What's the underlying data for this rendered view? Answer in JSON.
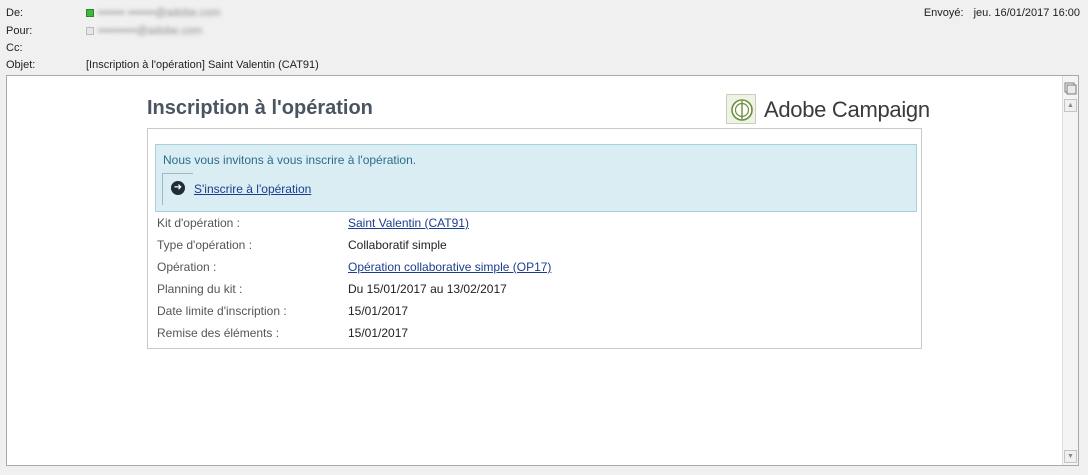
{
  "header": {
    "from_label": "De:",
    "from_value": "••••••• •••••••@adobe.com",
    "to_label": "Pour:",
    "to_value": "••••••••••@adobe.com",
    "cc_label": "Cc:",
    "subject_label": "Objet:",
    "subject_value": "[Inscription à l'opération] Saint Valentin (CAT91)",
    "sent_label": "Envoyé:",
    "sent_value": "jeu. 16/01/2017 16:00"
  },
  "email": {
    "title": "Inscription à l'opération",
    "brand": "Adobe Campaign",
    "invite_text": "Nous vous invitons à vous inscrire à l'opération.",
    "invite_link": "S'inscrire à l'opération",
    "details": [
      {
        "label": "Kit d'opération :",
        "value": "Saint Valentin (CAT91)"
      },
      {
        "label": "Type d'opération :",
        "value": "Collaboratif simple"
      },
      {
        "label": "Opération :",
        "value": "Opération collaborative simple (OP17)"
      },
      {
        "label": "Planning du kit :",
        "value": "Du 15/01/2017 au 13/02/2017"
      },
      {
        "label": "Date limite d'inscription :",
        "value": "15/01/2017"
      },
      {
        "label": "Remise des éléments :",
        "value": "15/01/2017"
      }
    ]
  },
  "icons": {
    "arrow": "arrow-right-circle-icon",
    "brand": "adobe-campaign-logo-icon"
  }
}
